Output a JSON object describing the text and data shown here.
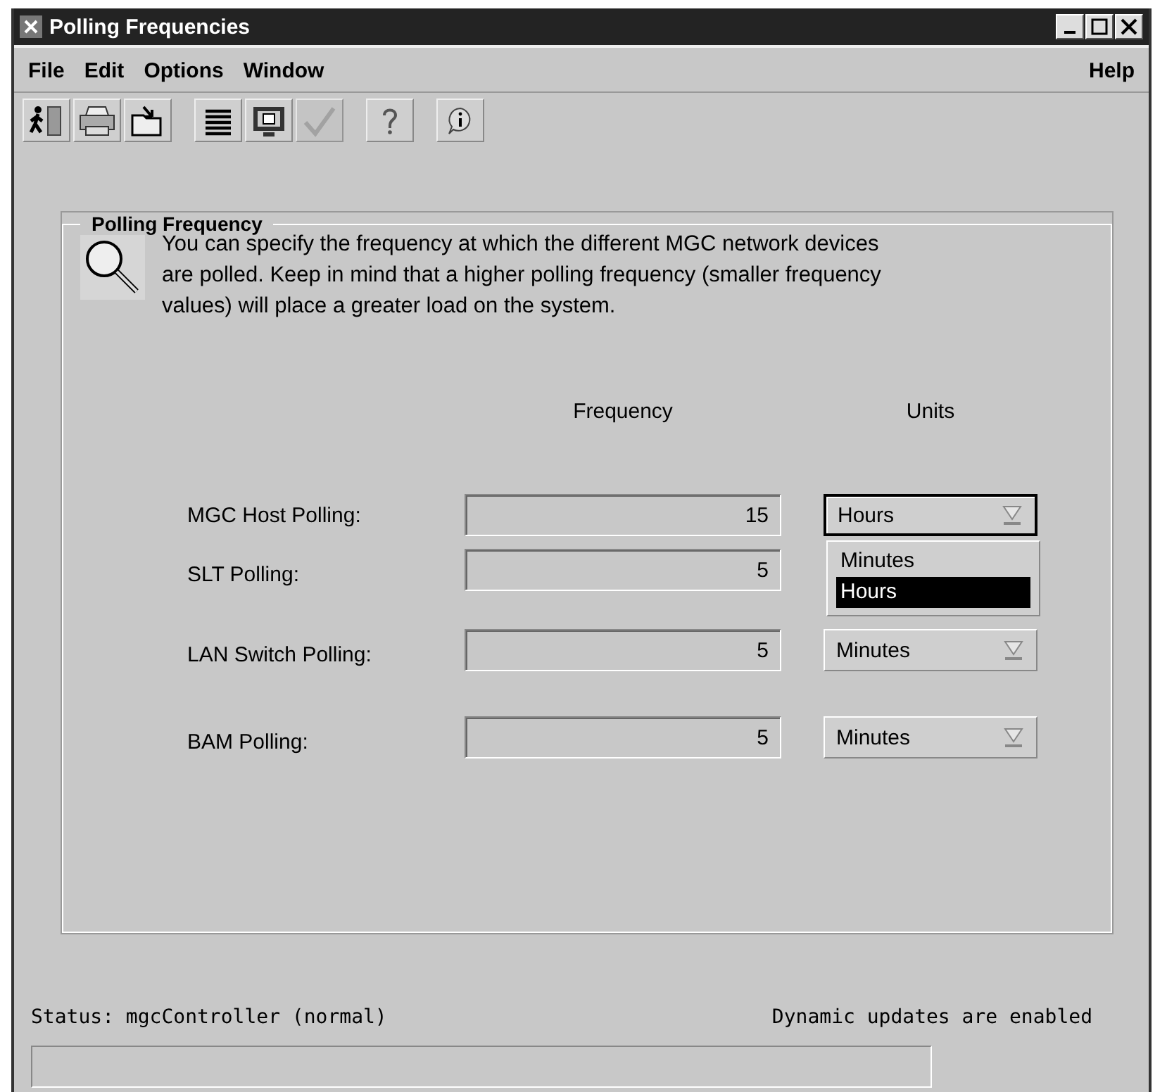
{
  "window": {
    "title": "Polling Frequencies"
  },
  "menu": [
    {
      "label": "File"
    },
    {
      "label": "Edit"
    },
    {
      "label": "Options"
    },
    {
      "label": "Window"
    }
  ],
  "help_menu": {
    "label": "Help"
  },
  "toolbar": [
    [
      {
        "kind": "exit",
        "disabled": false
      },
      {
        "kind": "print",
        "disabled": false
      },
      {
        "kind": "open",
        "disabled": false
      }
    ],
    [
      {
        "kind": "list",
        "disabled": false
      },
      {
        "kind": "monitor",
        "disabled": false
      },
      {
        "kind": "check",
        "disabled": true
      }
    ],
    [
      {
        "kind": "help",
        "disabled": false
      }
    ],
    [
      {
        "kind": "info",
        "disabled": false
      }
    ]
  ],
  "group": {
    "title": "Polling Frequency",
    "description": "You can specify the frequency at which the different MGC network devices are polled.  Keep in mind that a higher polling frequency (smaller frequency values) will place a greater load on the system.",
    "columns": [
      "Frequency",
      "Units"
    ],
    "rows": [
      {
        "label": "MGC Host Polling:",
        "frequency": "15",
        "unit": "Hours",
        "open": true
      },
      {
        "label": "SLT Polling:",
        "frequency": "5"
      },
      {
        "label": "LAN Switch Polling:",
        "frequency": "5",
        "unit": "Minutes",
        "open": false
      },
      {
        "label": "BAM Polling:",
        "frequency": "5",
        "unit": "Minutes",
        "open": false
      }
    ],
    "dropdown_options": [
      {
        "label": "Minutes",
        "selected": false
      },
      {
        "label": "Hours",
        "selected": true
      }
    ]
  },
  "status_bar": {
    "status": "Status: mgcController (normal)",
    "updates": "Dynamic updates are enabled"
  }
}
